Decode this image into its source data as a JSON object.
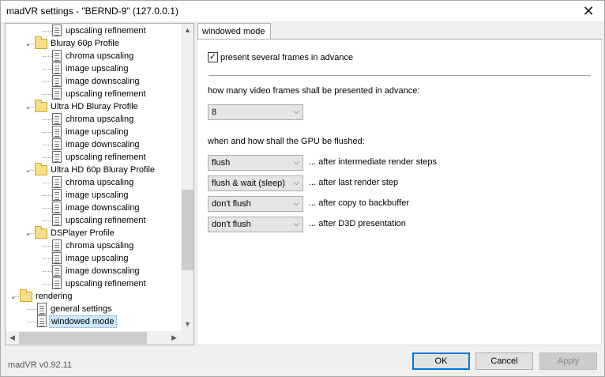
{
  "window": {
    "title": "madVR settings - \"BERND-9\" (127.0.0.1)",
    "close_glyph": "✕"
  },
  "tree": {
    "nodes": [
      {
        "label": "upscaling refinement",
        "type": "doc",
        "level": 2
      },
      {
        "label": "Bluray 60p Profile",
        "type": "folder",
        "level": 1,
        "expanded": true
      },
      {
        "label": "chroma upscaling",
        "type": "doc",
        "level": 2
      },
      {
        "label": "image upscaling",
        "type": "doc",
        "level": 2
      },
      {
        "label": "image downscaling",
        "type": "doc",
        "level": 2
      },
      {
        "label": "upscaling refinement",
        "type": "doc",
        "level": 2
      },
      {
        "label": "Ultra HD Bluray Profile",
        "type": "folder",
        "level": 1,
        "expanded": true
      },
      {
        "label": "chroma upscaling",
        "type": "doc",
        "level": 2
      },
      {
        "label": "image upscaling",
        "type": "doc",
        "level": 2
      },
      {
        "label": "image downscaling",
        "type": "doc",
        "level": 2
      },
      {
        "label": "upscaling refinement",
        "type": "doc",
        "level": 2
      },
      {
        "label": "Ultra HD 60p Bluray Profile",
        "type": "folder",
        "level": 1,
        "expanded": true
      },
      {
        "label": "chroma upscaling",
        "type": "doc",
        "level": 2
      },
      {
        "label": "image upscaling",
        "type": "doc",
        "level": 2
      },
      {
        "label": "image downscaling",
        "type": "doc",
        "level": 2
      },
      {
        "label": "upscaling refinement",
        "type": "doc",
        "level": 2
      },
      {
        "label": "DSPlayer Profile",
        "type": "folder",
        "level": 1,
        "expanded": true
      },
      {
        "label": "chroma upscaling",
        "type": "doc",
        "level": 2
      },
      {
        "label": "image upscaling",
        "type": "doc",
        "level": 2
      },
      {
        "label": "image downscaling",
        "type": "doc",
        "level": 2
      },
      {
        "label": "upscaling refinement",
        "type": "doc",
        "level": 2
      },
      {
        "label": "rendering",
        "type": "folder",
        "level": 0,
        "expanded": true
      },
      {
        "label": "general settings",
        "type": "doc",
        "level": 1
      },
      {
        "label": "windowed mode",
        "type": "doc",
        "level": 1,
        "selected": true
      }
    ]
  },
  "tab": {
    "label": "windowed mode"
  },
  "settings": {
    "present_frames_label": "present several frames in advance",
    "present_frames_checked": true,
    "frames_question": "how many video frames shall be presented in advance:",
    "frames_value": "8",
    "flush_question": "when and how shall the GPU be flushed:",
    "flush_rows": [
      {
        "value": "flush",
        "after": "... after intermediate render steps"
      },
      {
        "value": "flush & wait (sleep)",
        "after": "... after last render step"
      },
      {
        "value": "don't flush",
        "after": "... after copy to backbuffer"
      },
      {
        "value": "don't flush",
        "after": "... after D3D presentation"
      }
    ]
  },
  "footer": {
    "version": "madVR v0.92.11",
    "ok_label": "OK",
    "cancel_label": "Cancel",
    "apply_label": "Apply"
  }
}
